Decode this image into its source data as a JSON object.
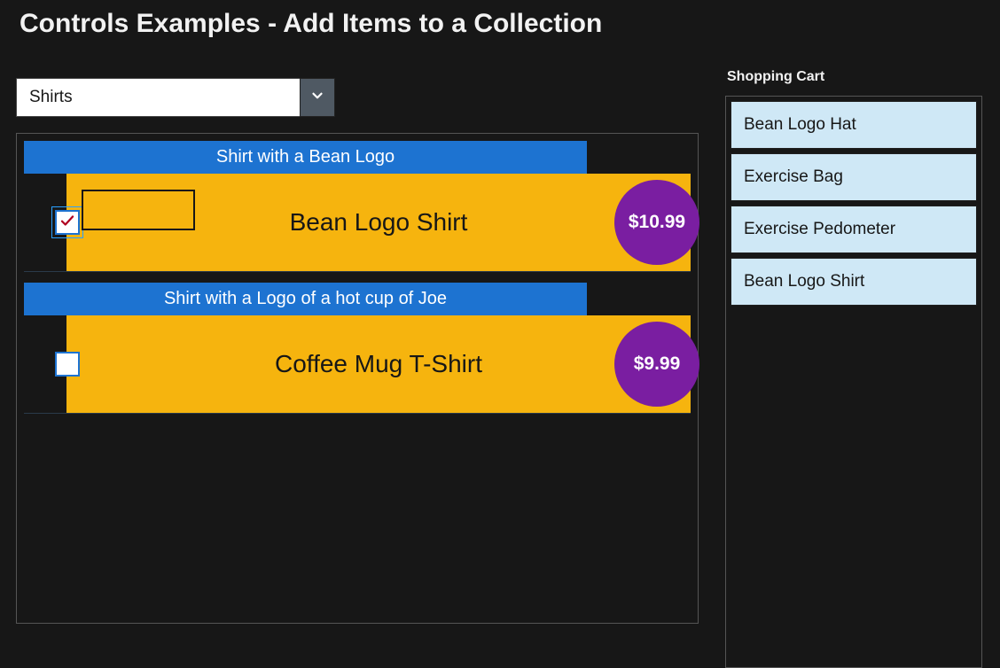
{
  "title": "Controls Examples - Add Items to a Collection",
  "dropdown": {
    "selected": "Shirts"
  },
  "products": [
    {
      "description": "Shirt with a Bean Logo",
      "name": "Bean Logo Shirt",
      "price": "$10.99",
      "checked": true,
      "has_image_placeholder": true,
      "focused": true
    },
    {
      "description": "Shirt with a Logo of a hot cup of Joe",
      "name": "Coffee Mug T-Shirt",
      "price": "$9.99",
      "checked": false,
      "has_image_placeholder": false,
      "focused": false
    }
  ],
  "cart": {
    "title": "Shopping Cart",
    "items": [
      "Bean Logo Hat",
      "Exercise Bag",
      "Exercise Pedometer",
      "Bean Logo Shirt"
    ]
  }
}
